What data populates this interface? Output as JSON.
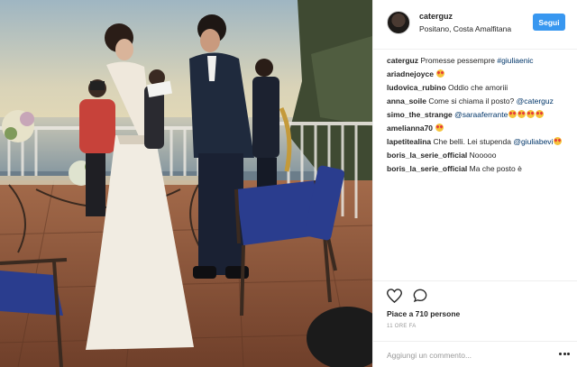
{
  "header": {
    "username": "caterguz",
    "location": "Positano, Costa Amalfitana",
    "follow_label": "Segui"
  },
  "comments": [
    {
      "user": "caterguz",
      "parts": [
        {
          "t": "Promesse pessempre "
        },
        {
          "t": "#giuliaenic",
          "link": true
        }
      ]
    },
    {
      "user": "ariadnejoyce",
      "parts": [
        {
          "t": ""
        }
      ],
      "emojis": 1
    },
    {
      "user": "ludovica_rubino",
      "parts": [
        {
          "t": "Oddio che amoriii"
        }
      ]
    },
    {
      "user": "anna_soile",
      "parts": [
        {
          "t": "Come si chiama il posto? "
        },
        {
          "t": "@caterguz",
          "link": true
        }
      ]
    },
    {
      "user": "simo_the_strange",
      "parts": [
        {
          "t": "@saraaferrante",
          "link": true
        }
      ],
      "emojis": 4
    },
    {
      "user": "amelianna70",
      "parts": [
        {
          "t": ""
        }
      ],
      "emojis": 1
    },
    {
      "user": "lapetitealina",
      "parts": [
        {
          "t": "Che belli. Lei stupenda "
        },
        {
          "t": "@giuliabevi",
          "link": true
        }
      ],
      "emojis": 1
    },
    {
      "user": "boris_la_serie_official",
      "parts": [
        {
          "t": "Nooooo"
        }
      ]
    },
    {
      "user": "boris_la_serie_official",
      "parts": [
        {
          "t": "Ma che posto è"
        }
      ]
    }
  ],
  "actions": {
    "likes": "Piace a 710 persone",
    "time": "11 ORE FA",
    "comment_placeholder": "Aggiungi un commento..."
  },
  "icons": {
    "like": "heart-outline-icon",
    "comment": "speech-bubble-icon",
    "more": "more-options-icon",
    "emoji": "heart-eyes-emoji"
  },
  "colors": {
    "accent": "#3897f0",
    "link": "#003569",
    "muted": "#999999"
  }
}
